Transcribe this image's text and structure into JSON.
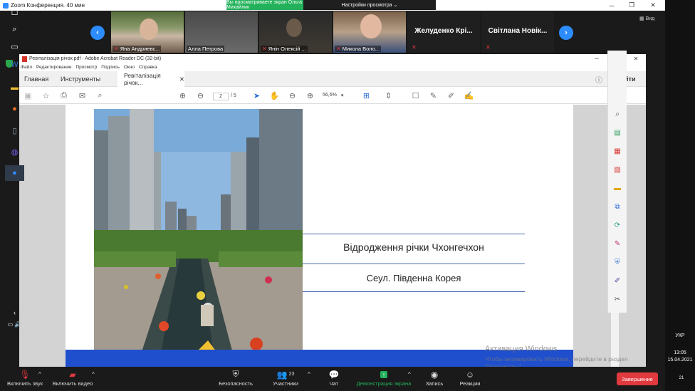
{
  "zoom": {
    "title": "Zoom Конференция. 40 мин",
    "share_banner": "Вы просматриваете экран Ольга Михайлик",
    "share_settings": "Настройки просмотра",
    "view_label": "Вид",
    "participants": [
      {
        "name": "Яна Андриевс..."
      },
      {
        "name": "Алла Петрова"
      },
      {
        "name": "Янін Олексій ..."
      },
      {
        "name": "Микола Воло..."
      }
    ],
    "name_tiles": [
      {
        "name": "Желуденко Крі..."
      },
      {
        "name": "Світлана Новік..."
      }
    ],
    "controls": {
      "audio": "Включить звук",
      "video": "Включить видео",
      "security": "Безопасность",
      "participants": "Участники",
      "participants_count": "23",
      "chat": "Чат",
      "share": "Демонстрация экрана",
      "record": "Запись",
      "reactions": "Реакции",
      "end": "Завершение"
    }
  },
  "acrobat": {
    "title": "Ревіталізація річок.pdf - Adobe Acrobat Reader DC (32-bit)",
    "menu": [
      "Файл",
      "Редактирование",
      "Просмотр",
      "Подпись",
      "Окно",
      "Справка"
    ],
    "tabs": {
      "home": "Главная",
      "tools": "Инструменты",
      "doc": "Ревіталізація річок..."
    },
    "login": "Войти",
    "page_current": "2",
    "page_total": "/ 5",
    "zoom_level": "56,6%",
    "slide": {
      "title": "Відродження річки Чхонгечхон",
      "subtitle": "Сеул. Південна Корея",
      "accent_color": "#1f4fcc"
    }
  },
  "windows": {
    "watermark_title": "Активация Windows",
    "watermark_text": "Чтобы активировать Windows, перейдите в раздел \"Параметры\".",
    "lang": "УКР",
    "time": "13:05",
    "date": "15.04.2021",
    "notifications": "21"
  }
}
